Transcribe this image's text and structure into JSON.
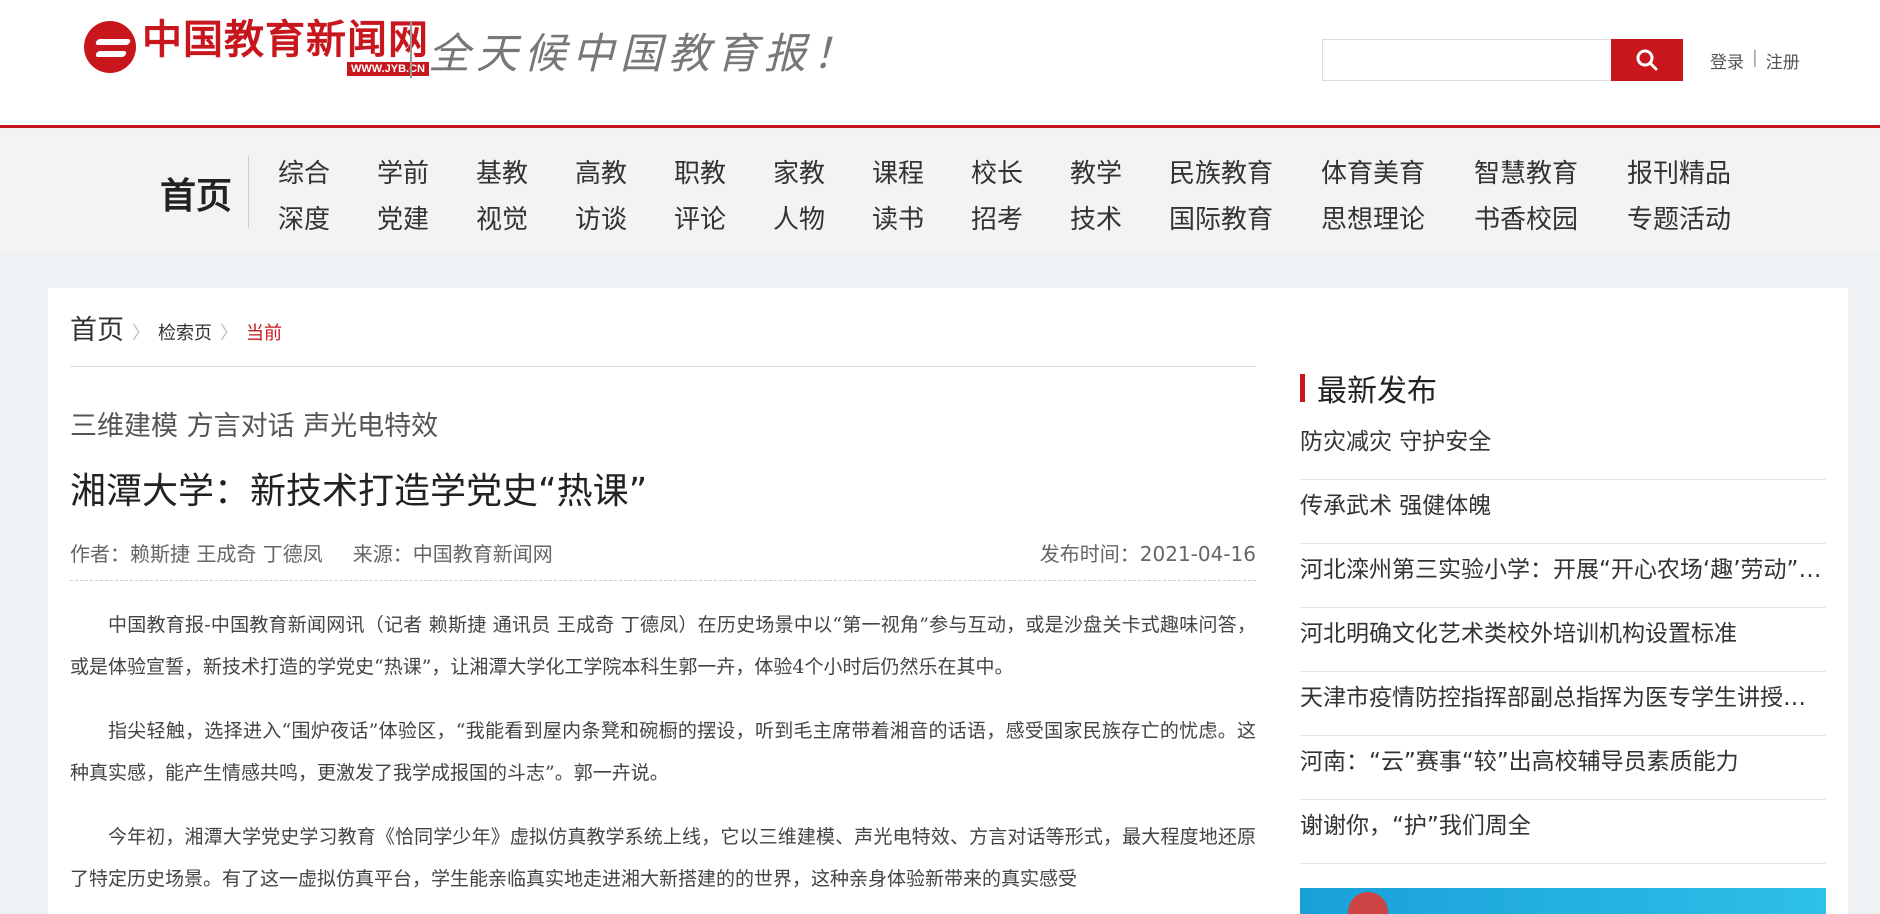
{
  "header": {
    "logo_name": "中国教育新闻网",
    "logo_url": "WWW.JYB.CN",
    "slogan": "全天候中国教育报！",
    "search": {
      "value": "",
      "placeholder": ""
    },
    "login": "登录",
    "auth_separator": "|",
    "register": "注册"
  },
  "nav": {
    "home": "首页",
    "items": [
      "综合",
      "学前",
      "基教",
      "高教",
      "职教",
      "家教",
      "课程",
      "校长",
      "教学",
      "民族教育",
      "体育美育",
      "智慧教育",
      "报刊精品",
      "深度",
      "党建",
      "视觉",
      "访谈",
      "评论",
      "人物",
      "读书",
      "招考",
      "技术",
      "国际教育",
      "思想理论",
      "书香校园",
      "专题活动"
    ]
  },
  "breadcrumb": {
    "home": "首页",
    "sep": "〉",
    "search_page": "检索页",
    "current": "当前"
  },
  "article": {
    "subtitle": "三维建模 方言对话 声光电特效",
    "title": "湘潭大学：新技术打造学党史“热课”",
    "author": "作者：赖斯捷 王成奇 丁德凤",
    "source": "来源：中国教育新闻网",
    "pubtime": "发布时间：2021-04-16",
    "paragraphs": [
      "中国教育报-中国教育新闻网讯（记者 赖斯捷 通讯员 王成奇 丁德凤）在历史场景中以“第一视角”参与互动，或是沙盘关卡式趣味问答，或是体验宣誓，新技术打造的学党史“热课”，让湘潭大学化工学院本科生郭一卉，体验4个小时后仍然乐在其中。",
      "指尖轻触，选择进入“围炉夜话”体验区，“我能看到屋内条凳和碗橱的摆设，听到毛主席带着湘音的话语，感受国家民族存亡的忧虑。这种真实感，能产生情感共鸣，更激发了我学成报国的斗志”。郭一卉说。",
      "今年初，湘潭大学党史学习教育《恰同学少年》虚拟仿真教学系统上线，它以三维建模、声光电特效、方言对话等形式，最大程度地还原了特定历史场景。有了这一虚拟仿真平台，学生能亲临真实地走进湘大新搭建的的世界，这种亲身体验新带来的真实感受"
    ]
  },
  "sidebar": {
    "title": "最新发布",
    "items": [
      "防灾减灾 守护安全",
      "传承武术 强健体魄",
      "河北滦州第三实验小学：开展“开心农场‘趣’劳动”活动",
      "河北明确文化艺术类校外培训机构设置标准",
      "天津市疫情防控指挥部副总指挥为医专学生讲授思政课",
      "河南：“云”赛事“较”出高校辅导员素质能力",
      "谢谢你，“护”我们周全"
    ]
  },
  "colors": {
    "accent": "#c8161d",
    "page_bg": "#eef2f5"
  }
}
